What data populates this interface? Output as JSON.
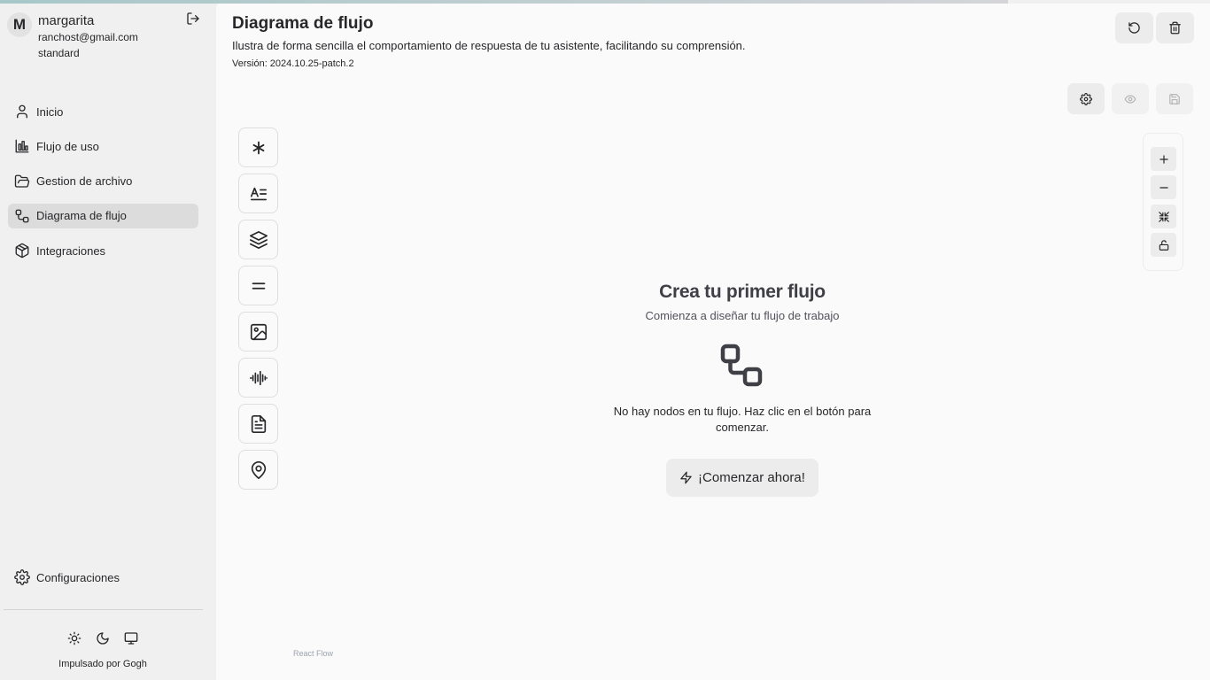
{
  "progress": {
    "value": 0.833
  },
  "user": {
    "initial": "M",
    "name": "margarita",
    "email": "ranchost@gmail.com",
    "plan": "standard"
  },
  "nav": [
    {
      "label": "Inicio",
      "icon": "user-icon",
      "active": false
    },
    {
      "label": "Flujo de uso",
      "icon": "bar-chart-icon",
      "active": false
    },
    {
      "label": "Gestion de archivo",
      "icon": "folder-open-icon",
      "active": false
    },
    {
      "label": "Diagrama de flujo",
      "icon": "workflow-icon",
      "active": true
    },
    {
      "label": "Integraciones",
      "icon": "package-icon",
      "active": false
    }
  ],
  "footer": {
    "config_label": "Configuraciones",
    "powered_by": "Impulsado por Gogh"
  },
  "page": {
    "title": "Diagrama de flujo",
    "description": "Ilustra de forma sencilla el comportamiento de respuesta de tu asistente, facilitando su comprensión.",
    "version": "Versión: 2024.10.25-patch.2"
  },
  "empty_state": {
    "title": "Crea tu primer flujo",
    "subtitle": "Comienza a diseñar tu flujo de trabajo",
    "message": "No hay nodos en tu flujo. Haz clic en el botón para comenzar.",
    "button_label": "¡Comenzar ahora!"
  },
  "tools": [
    "asterisk-icon",
    "text-align-icon",
    "layers-icon",
    "equals-icon",
    "image-icon",
    "audio-waveform-icon",
    "file-text-icon",
    "map-pin-icon"
  ],
  "react_flow_label": "React Flow",
  "colors": {
    "sidebar_bg": "#f0f0f0",
    "main_bg": "#fafafa",
    "active_nav": "#dcdcdc",
    "button_bg": "#ececec",
    "text": "#27272a"
  }
}
